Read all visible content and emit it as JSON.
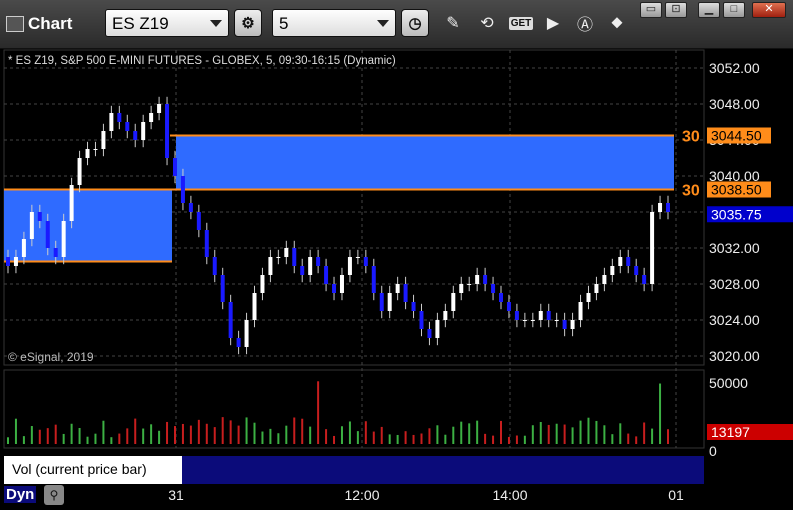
{
  "toolbar": {
    "title": "Chart",
    "symbol": "ES Z19",
    "interval": "5",
    "get_label": "GET"
  },
  "chart": {
    "info": "* ES Z19, S&P 500 E-MINI FUTURES - GLOBEX, 5, 09:30-16:15 (Dynamic)",
    "copyright": "© eSignal, 2019",
    "price_ticks": [
      "3052.00",
      "3048.00",
      "3044.00",
      "3040.00",
      "3036.00",
      "3032.00",
      "3028.00",
      "3024.00",
      "3020.00"
    ],
    "time_ticks": [
      "31",
      "12:00",
      "14:00",
      "01"
    ],
    "vol_ticks": [
      "50000",
      "0"
    ],
    "level_labels": {
      "upper_value": "3044.50",
      "lower_value": "3038.50",
      "upper_tag": "30",
      "lower_tag": "30",
      "last_price": "3035.75",
      "last_volume": "13197"
    },
    "vol_study_label": "Vol (current price bar)",
    "vol_close": "x",
    "dyn_label": "Dyn",
    "colors": {
      "up_candle": "#ffffff",
      "down_candle": "#1a1aff",
      "zone_fill": "#2f6bff",
      "zone_line": "#ff8c1a",
      "vol_up": "#3cb043",
      "vol_down": "#c81e1e",
      "last_price_bg": "#0000cc",
      "last_vol_bg": "#cc0000"
    }
  },
  "chart_data": {
    "type": "candlestick",
    "title": "",
    "ylim": [
      3019,
      3054
    ],
    "zones": [
      {
        "top": 3038.5,
        "bottom": 3030.5,
        "x_start": "prev-close",
        "x_end": "31"
      },
      {
        "top": 3044.5,
        "bottom": 3038.5,
        "x_start": "31",
        "x_end": "01"
      }
    ],
    "closes": [
      3030,
      3031,
      3033,
      3036,
      3035,
      3032,
      3031,
      3035,
      3039,
      3042,
      3043,
      3043,
      3045,
      3047,
      3046,
      3045,
      3044,
      3046,
      3047,
      3048,
      3042,
      3040,
      3037,
      3036,
      3034,
      3031,
      3029,
      3026,
      3022,
      3021,
      3024,
      3027,
      3029,
      3031,
      3031,
      3032,
      3030,
      3029,
      3031,
      3030,
      3028,
      3027,
      3029,
      3031,
      3031,
      3030,
      3027,
      3025,
      3027,
      3028,
      3026,
      3025,
      3023,
      3022,
      3024,
      3025,
      3027,
      3028,
      3028,
      3029,
      3028,
      3027,
      3026,
      3025,
      3024,
      3024,
      3024,
      3025,
      3024,
      3024,
      3023,
      3024,
      3026,
      3027,
      3028,
      3029,
      3030,
      3031,
      3030,
      3029,
      3028,
      3036,
      3037,
      3036
    ],
    "volume_max": 50000,
    "last_volume": 13197
  }
}
